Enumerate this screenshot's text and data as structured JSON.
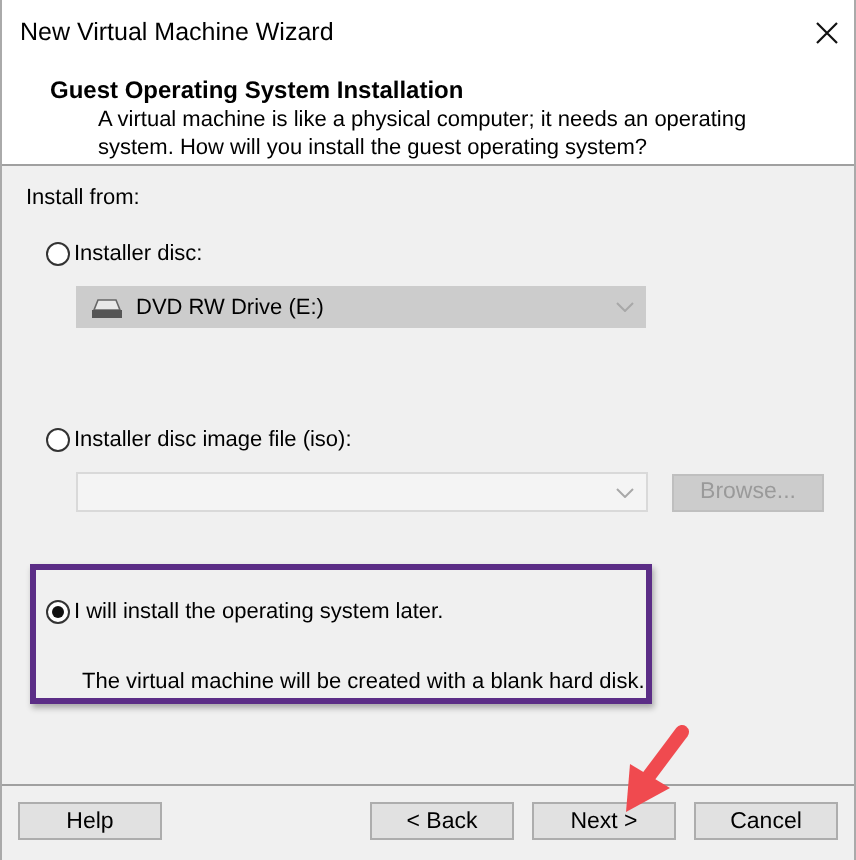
{
  "window": {
    "title": "New Virtual Machine Wizard"
  },
  "header": {
    "title": "Guest Operating System Installation",
    "description": "A virtual machine is like a physical computer; it needs an operating system. How will you install the guest operating system?"
  },
  "install_from": "Install from:",
  "options": [
    {
      "kind": "disc",
      "label": "Installer disc:",
      "selected": false,
      "highlighted": false,
      "drive": "DVD RW Drive (E:)",
      "disabled": true
    },
    {
      "kind": "iso",
      "label": "Installer disc image file (iso):",
      "selected": false,
      "highlighted": false,
      "browse": "Browse...",
      "disabled": true
    },
    {
      "kind": "later",
      "label": "I will install the operating system later.",
      "selected": true,
      "highlighted": true,
      "note": "The virtual machine will be created with a blank hard disk."
    }
  ],
  "buttons": [
    {
      "kind": "help",
      "label": "Help",
      "pointed": false
    },
    {
      "kind": "nav",
      "label": "< Back",
      "pointed": false
    },
    {
      "kind": "nav",
      "label": "Next >",
      "pointed": true
    },
    {
      "kind": "nav",
      "label": "Cancel",
      "pointed": false
    }
  ]
}
